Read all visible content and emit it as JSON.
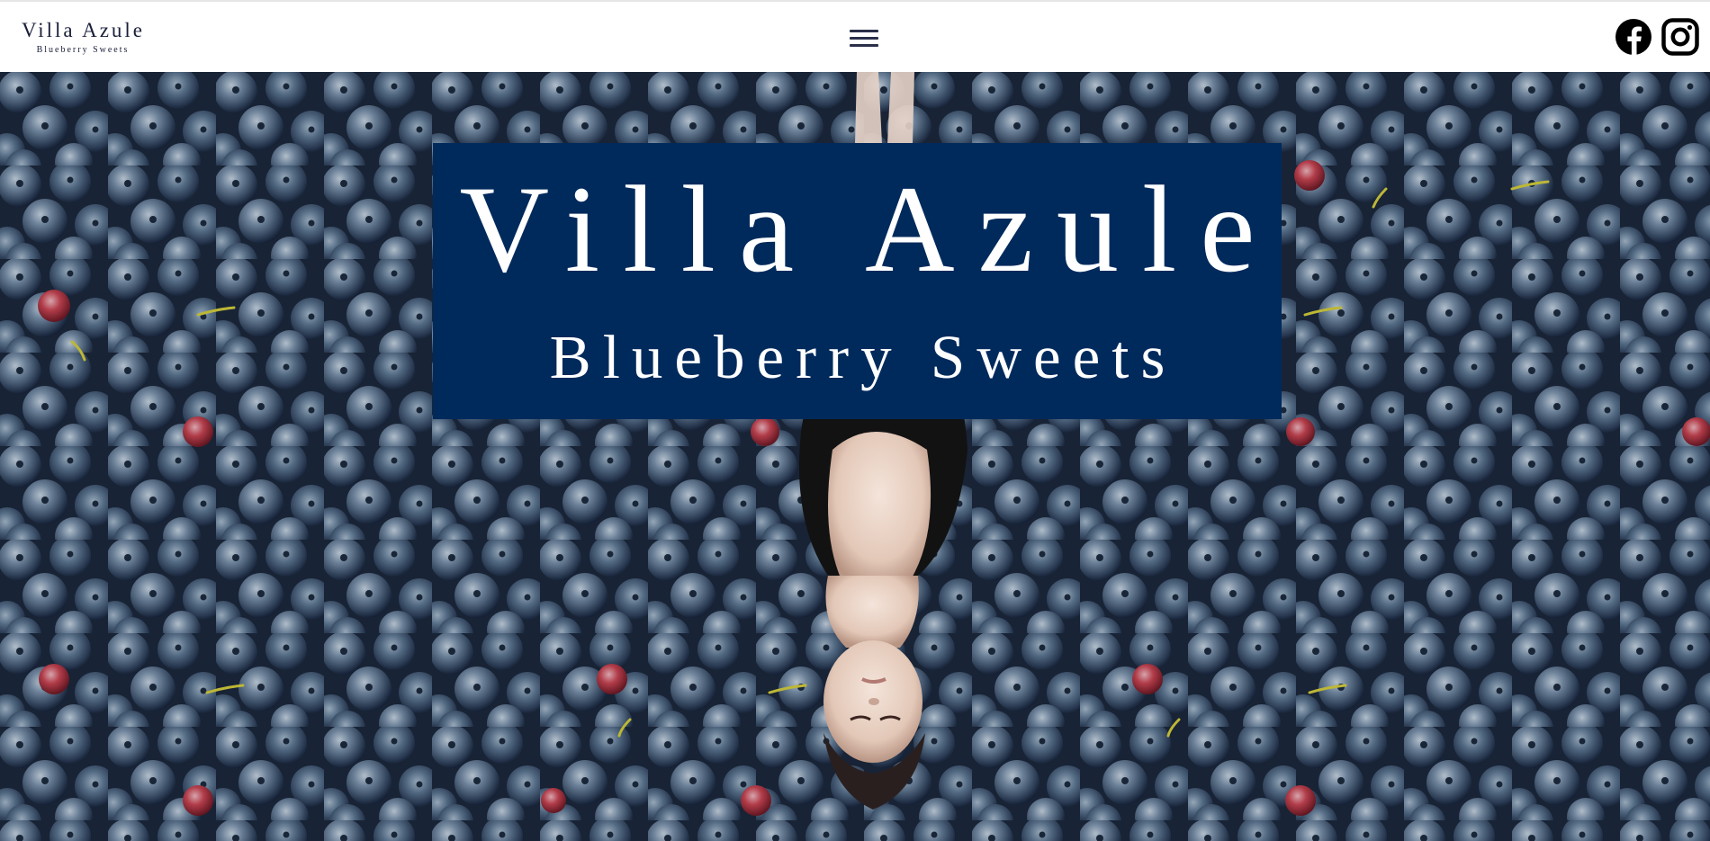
{
  "header": {
    "logo_title": "Villa Azule",
    "logo_subtitle": "Blueberry Sweets",
    "menu_icon": "hamburger-menu-icon",
    "social": [
      {
        "name": "facebook-icon"
      },
      {
        "name": "instagram-icon"
      }
    ]
  },
  "hero": {
    "title": "Villa Azule",
    "subtitle": "Blueberry Sweets",
    "card_color": "#002a5c",
    "background_description_icon": "blueberries-photo"
  },
  "colors": {
    "brand_navy": "#002a5c",
    "header_text": "#1a1f3a",
    "berry_blue": "#4a6480"
  }
}
